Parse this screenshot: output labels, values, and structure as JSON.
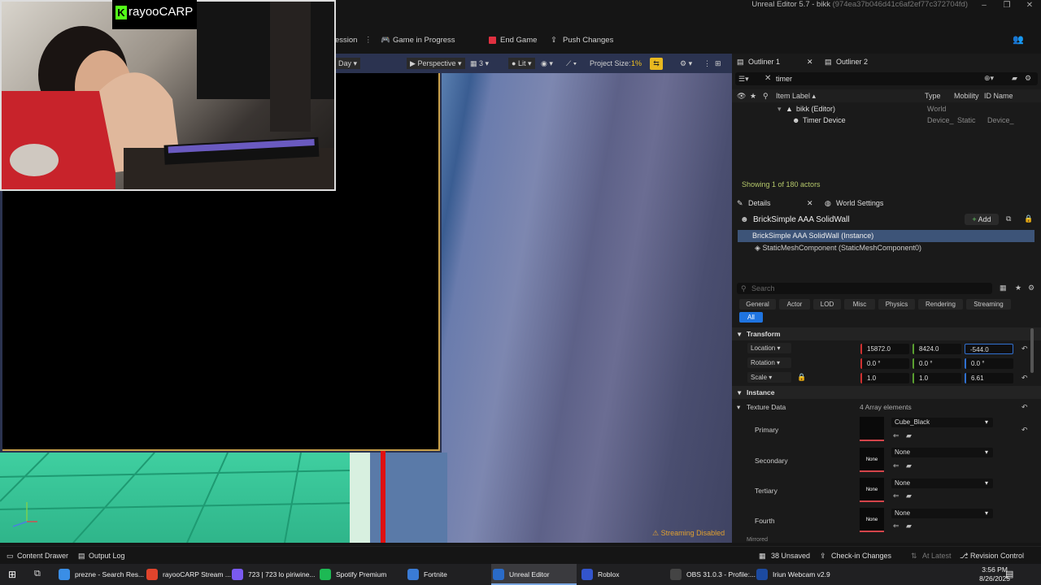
{
  "window": {
    "title": "Unreal Editor 5.7 - bikk",
    "hash": "(974ea37b046d41c6af2ef77c372704fd)",
    "controls": [
      "–",
      "❐",
      "✕"
    ]
  },
  "toolbar": {
    "session": "ession",
    "game_status": "Game in Progress",
    "end_game": "End Game",
    "push_changes": "Push Changes"
  },
  "viewport": {
    "day": "Day",
    "perspective": "Perspective",
    "camera_speed": "3",
    "lit": "Lit",
    "project_size_label": "Project Size:",
    "project_size_value": "1%",
    "streaming": "Streaming Disabled"
  },
  "webcam": {
    "streamer_name": "rayooCARP",
    "logo_letter": "K"
  },
  "outliner": {
    "tabs": [
      "Outliner 1",
      "Outliner 2"
    ],
    "search_value": "timer",
    "columns": {
      "label": "Item Label ▴",
      "type": "Type",
      "mobility": "Mobility",
      "id": "ID Name"
    },
    "rows": [
      {
        "label": "bikk (Editor)",
        "type": "World",
        "mobility": "",
        "id": ""
      },
      {
        "label": "Timer Device",
        "type": "Device_",
        "mobility": "Static",
        "id": "Device_"
      }
    ],
    "showing": "Showing 1 of 180 actors"
  },
  "details": {
    "tabs": [
      "Details",
      "World Settings"
    ],
    "object_name": "BrickSimple AAA SolidWall",
    "add_label": "Add",
    "instance_row": "BrickSimple AAA SolidWall (Instance)",
    "component_row": "StaticMeshComponent (StaticMeshComponent0)",
    "search_placeholder": "Search",
    "categories": [
      "General",
      "Actor",
      "LOD",
      "Misc",
      "Physics",
      "Rendering",
      "Streaming"
    ],
    "category_all": "All",
    "transform_section": "Transform",
    "location_label": "Location",
    "rotation_label": "Rotation",
    "scale_label": "Scale",
    "location": [
      "15872.0",
      "8424.0",
      "-544.0"
    ],
    "rotation": [
      "0.0 °",
      "0.0 °",
      "0.0 °"
    ],
    "scale": [
      "1.0",
      "1.0",
      "6.61"
    ],
    "instance_section": "Instance",
    "texture_data_label": "Texture Data",
    "texture_data_value": "4 Array elements",
    "slots": [
      {
        "label": "Primary",
        "value": "Cube_Black",
        "swatch": ""
      },
      {
        "label": "Secondary",
        "value": "None",
        "swatch": "None"
      },
      {
        "label": "Tertiary",
        "value": "None",
        "swatch": "None"
      },
      {
        "label": "Fourth",
        "value": "None",
        "swatch": "None"
      }
    ],
    "mirrored_label": "Mirrored"
  },
  "statusbar": {
    "content_drawer": "Content Drawer",
    "output_log": "Output Log",
    "unsaved": "38 Unsaved",
    "checkin": "Check-in Changes",
    "at_latest": "At Latest",
    "revision": "Revision Control"
  },
  "taskbar": {
    "items": [
      {
        "label": "prezne - Search Res...",
        "color": "#3a8ee6"
      },
      {
        "label": "rayooCARP Stream ...",
        "color": "#e0442c"
      },
      {
        "label": "723 | 723 lo piriwine...",
        "color": "#7a5af0"
      },
      {
        "label": "Spotify Premium",
        "color": "#1db954"
      },
      {
        "label": "Fortnite",
        "color": "#3a7bd5"
      },
      {
        "label": "Unreal Editor",
        "color": "#2a6bc8"
      },
      {
        "label": "Roblox",
        "color": "#3355cc"
      },
      {
        "label": "OBS 31.0.3 - Profile:...",
        "color": "#444"
      },
      {
        "label": "Iriun Webcam v2.9",
        "color": "#1c4aa0"
      }
    ],
    "time": "3:56 PM",
    "date": "8/26/2025"
  }
}
